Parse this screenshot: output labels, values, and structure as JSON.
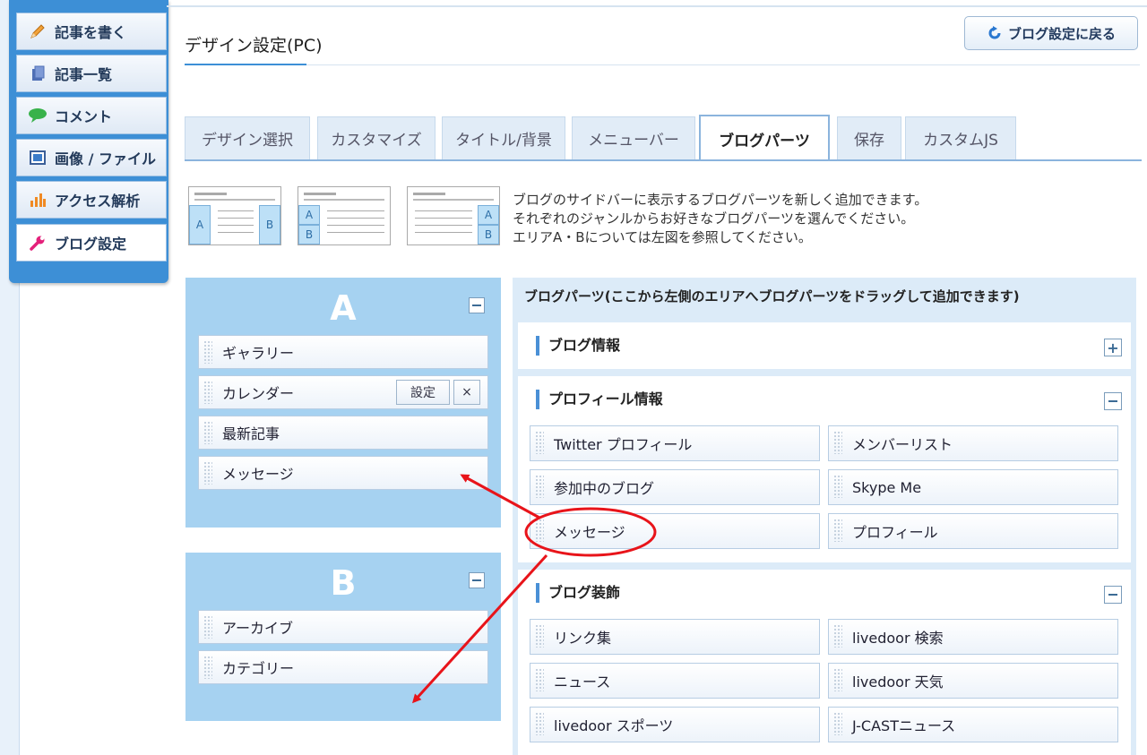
{
  "sidebar": {
    "items": [
      {
        "label": "記事を書く",
        "icon": "pencil-icon"
      },
      {
        "label": "記事一覧",
        "icon": "document-icon"
      },
      {
        "label": "コメント",
        "icon": "speech-bubble-icon"
      },
      {
        "label": "画像 / ファイル",
        "icon": "image-icon"
      },
      {
        "label": "アクセス解析",
        "icon": "bar-chart-icon"
      },
      {
        "label": "ブログ設定",
        "icon": "wrench-icon"
      }
    ]
  },
  "header": {
    "title": "デザイン設定(PC)",
    "back_button": "ブログ設定に戻る"
  },
  "tabs": [
    {
      "label": "デザイン選択"
    },
    {
      "label": "カスタマイズ"
    },
    {
      "label": "タイトル/背景"
    },
    {
      "label": "メニューバー"
    },
    {
      "label": "ブログパーツ"
    },
    {
      "label": "保存"
    },
    {
      "label": "カスタムJS"
    }
  ],
  "intro": {
    "line1": "ブログのサイドバーに表示するブログパーツを新しく追加できます。",
    "line2": "それぞれのジャンルからお好きなブログパーツを選んでください。",
    "line3": "エリアA・Bについては左図を参照してください。"
  },
  "thumbs": {
    "a": "A",
    "b": "B"
  },
  "area_a": {
    "letter": "A",
    "items": [
      "ギャラリー",
      "カレンダー",
      "最新記事",
      "メッセージ"
    ],
    "settings_button": "設定",
    "remove_button": "×"
  },
  "area_b": {
    "letter": "B",
    "items": [
      "アーカイブ",
      "カテゴリー"
    ]
  },
  "parts": {
    "header": "ブログパーツ(ここから左側のエリアへブログパーツをドラッグして追加できます)",
    "sections": [
      {
        "title": "ブログ情報",
        "toggle": "+"
      },
      {
        "title": "プロフィール情報",
        "toggle": "−",
        "items": [
          "Twitter プロフィール",
          "メンバーリスト",
          "参加中のブログ",
          "Skype Me",
          "メッセージ",
          "プロフィール"
        ]
      },
      {
        "title": "ブログ装飾",
        "toggle": "−",
        "items": [
          "リンク集",
          "livedoor 検索",
          "ニュース",
          "livedoor 天気",
          "livedoor スポーツ",
          "J-CASTニュース"
        ]
      }
    ]
  },
  "colors": {
    "accent": "#3d8fd6",
    "annotation": "#e8141a",
    "area_bg": "#a6d2f1"
  }
}
